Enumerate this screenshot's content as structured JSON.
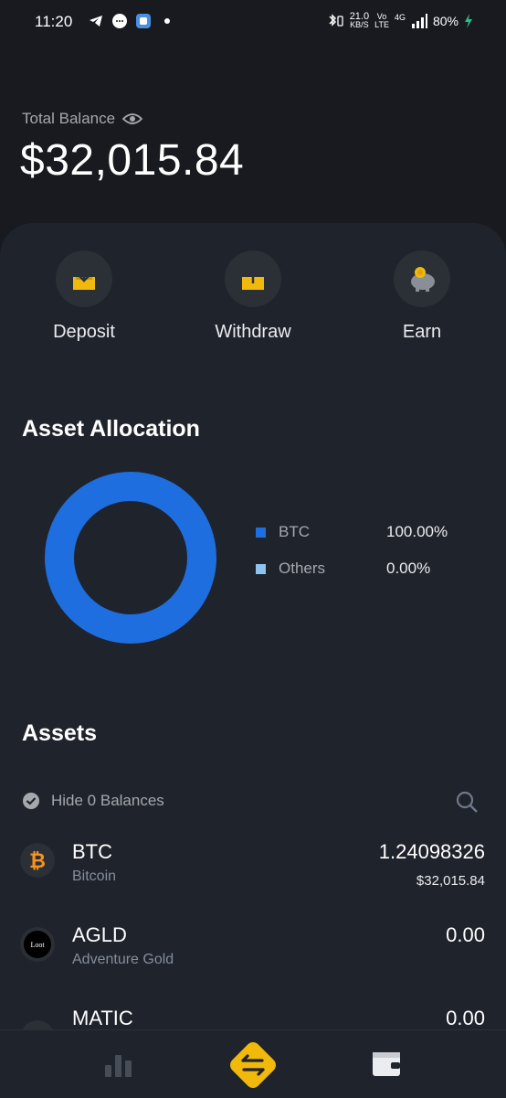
{
  "status": {
    "time": "11:20",
    "net_speed_value": "21.0",
    "net_speed_unit": "KB/S",
    "volte_top": "Vo",
    "volte_bottom": "LTE",
    "network": "4G",
    "battery": "80%"
  },
  "balance": {
    "label": "Total Balance",
    "value": "$32,015.84"
  },
  "actions": [
    {
      "label": "Deposit",
      "icon": "deposit-icon"
    },
    {
      "label": "Withdraw",
      "icon": "withdraw-icon"
    },
    {
      "label": "Earn",
      "icon": "piggy-bank-icon"
    }
  ],
  "allocation": {
    "title": "Asset Allocation",
    "items": [
      {
        "name": "BTC",
        "value": "100.00%",
        "share": 1.0,
        "color": "#1e6ee0"
      },
      {
        "name": "Others",
        "value": "0.00%",
        "share": 0.0,
        "color": "#8fc3ef"
      }
    ]
  },
  "assets": {
    "title": "Assets",
    "hide_label": "Hide 0 Balances",
    "rows": [
      {
        "symbol": "BTC",
        "name": "Bitcoin",
        "amount": "1.24098326",
        "usd": "$32,015.84",
        "icon": "bitcoin-icon"
      },
      {
        "symbol": "AGLD",
        "name": "Adventure Gold",
        "amount": "0.00",
        "usd": "",
        "icon": "loot-icon"
      },
      {
        "symbol": "MATIC",
        "name": "",
        "amount": "0.00",
        "usd": "",
        "icon": "polygon-icon"
      }
    ]
  },
  "nav": {
    "items": [
      "markets-icon",
      "trade-icon",
      "wallet-icon"
    ],
    "accent": "#f0b90b"
  }
}
